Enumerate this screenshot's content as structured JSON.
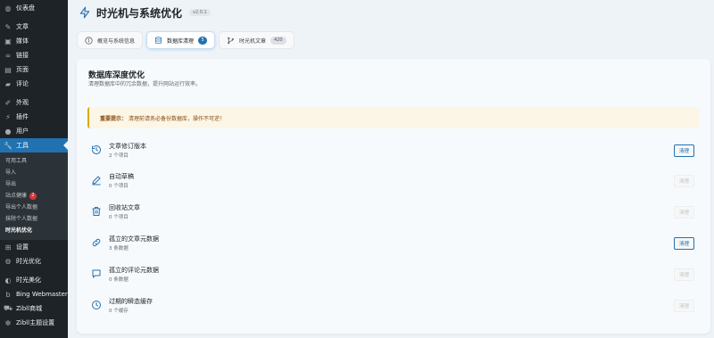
{
  "sidebar": {
    "items": [
      {
        "label": "仪表盘",
        "icon": "dashboard-icon"
      },
      {
        "label": "文章",
        "icon": "pin-icon"
      },
      {
        "label": "媒体",
        "icon": "media-icon"
      },
      {
        "label": "链接",
        "icon": "link-icon"
      },
      {
        "label": "页面",
        "icon": "page-icon"
      },
      {
        "label": "评论",
        "icon": "comment-icon"
      },
      {
        "label": "外观",
        "icon": "brush-icon"
      },
      {
        "label": "插件",
        "icon": "plugin-icon"
      },
      {
        "label": "用户",
        "icon": "user-icon"
      },
      {
        "label": "工具",
        "icon": "wrench-icon"
      },
      {
        "label": "设置",
        "icon": "settings-icon"
      },
      {
        "label": "时光优化",
        "icon": "gear-icon"
      },
      {
        "label": "时光美化",
        "icon": "palette-icon"
      },
      {
        "label": "Bing Webmaster",
        "icon": "bing-icon"
      },
      {
        "label": "Zibll商城",
        "icon": "cart-icon"
      },
      {
        "label": "Zibll主题设置",
        "icon": "cog-icon"
      }
    ],
    "tools_submenu": [
      {
        "label": "可用工具"
      },
      {
        "label": "导入"
      },
      {
        "label": "导出"
      },
      {
        "label": "站点健康",
        "badge": "2"
      },
      {
        "label": "导出个人数据"
      },
      {
        "label": "抹除个人数据"
      },
      {
        "label": "时光机优化"
      }
    ]
  },
  "header": {
    "title": "时光机与系统优化",
    "version": "v2.0.1"
  },
  "tabs": [
    {
      "label": "概览与系统信息",
      "icon": "info-icon"
    },
    {
      "label": "数据库清理",
      "count": "5",
      "icon": "database-icon"
    },
    {
      "label": "时光机文章",
      "count": "420",
      "icon": "branch-icon"
    }
  ],
  "card": {
    "title": "数据库深度优化",
    "description": "清理数据库中的冗余数据，提升网站运行效率。",
    "notice_strong": "重要提示：",
    "notice_text": "清理前请务必备份数据库，操作不可逆！",
    "rows": [
      {
        "title": "文章修订版本",
        "count": "2 个项目",
        "button": "清理",
        "enabled": true,
        "icon": "history-icon"
      },
      {
        "title": "自动草稿",
        "count": "0 个项目",
        "button": "清理",
        "enabled": false,
        "icon": "pencil-icon"
      },
      {
        "title": "回收站文章",
        "count": "0 个项目",
        "button": "清理",
        "enabled": false,
        "icon": "trash-icon"
      },
      {
        "title": "孤立的文章元数据",
        "count": "3 条数据",
        "button": "清理",
        "enabled": true,
        "icon": "link-icon"
      },
      {
        "title": "孤立的评论元数据",
        "count": "0 条数据",
        "button": "清理",
        "enabled": false,
        "icon": "comment-icon"
      },
      {
        "title": "过期的瞬态缓存",
        "count": "0 个缓存",
        "button": "清理",
        "enabled": false,
        "icon": "clock-icon"
      }
    ]
  },
  "colors": {
    "accent": "#2271b1",
    "sidebar": "#1d2327",
    "notice": "#dba617"
  }
}
